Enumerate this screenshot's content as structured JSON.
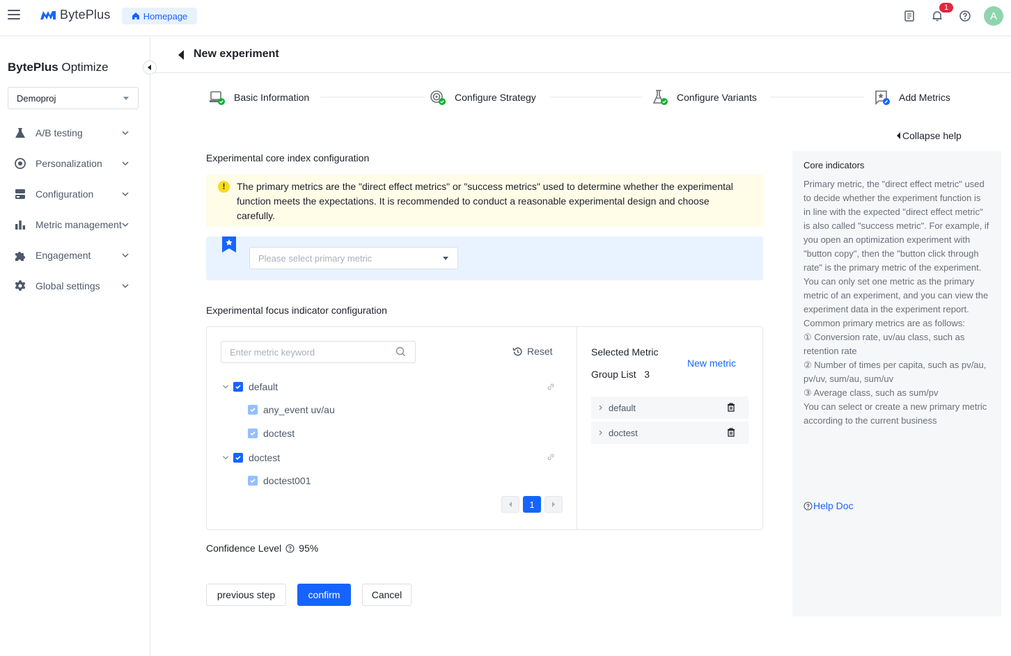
{
  "topbar": {
    "brand": "BytePlus",
    "home_label": "Homepage",
    "notification_count": "1",
    "avatar_initial": "A",
    "icons": [
      "menu-icon",
      "document-icon",
      "bell-icon",
      "help-icon"
    ]
  },
  "sidebar": {
    "title_bold": "BytePlus",
    "title_light": " Optimize",
    "project": "Demoproj",
    "items": [
      {
        "label": "A/B testing",
        "icon": "flask-icon"
      },
      {
        "label": "Personalization",
        "icon": "target-icon"
      },
      {
        "label": "Configuration",
        "icon": "server-icon"
      },
      {
        "label": "Metric management",
        "icon": "bar-chart-icon"
      },
      {
        "label": "Engagement",
        "icon": "puzzle-icon"
      },
      {
        "label": "Global settings",
        "icon": "gear-icon"
      }
    ]
  },
  "page": {
    "title": "New experiment"
  },
  "steps": [
    {
      "label": "Basic Information",
      "status": "done"
    },
    {
      "label": "Configure Strategy",
      "status": "done"
    },
    {
      "label": "Configure Variants",
      "status": "done"
    },
    {
      "label": "Add Metrics",
      "status": "current"
    }
  ],
  "core": {
    "section_title": "Experimental core index configuration",
    "alert_text": "The primary metrics are the \"direct effect metrics\" or \"success metrics\" used to determine whether the experimental function meets the expectations. It is recommended to conduct a reasonable experimental design and choose carefully.",
    "primary_placeholder": "Please select primary metric"
  },
  "focus": {
    "section_title": "Experimental focus indicator configuration",
    "search_placeholder": "Enter metric keyword",
    "reset_label": "Reset",
    "tree": [
      {
        "label": "default",
        "children": [
          "any_event uv/au",
          "doctest"
        ]
      },
      {
        "label": "doctest",
        "children": [
          "doctest001"
        ]
      }
    ],
    "pagination": {
      "current_page": "1"
    },
    "selected_metric_label": "Selected Metric",
    "group_list_label": "Group List",
    "group_count": "3",
    "new_metric_label": "New metric",
    "groups": [
      "default",
      "doctest"
    ]
  },
  "confidence": {
    "label": "Confidence Level",
    "value": "95%"
  },
  "actions": {
    "previous": "previous step",
    "confirm": "confirm",
    "cancel": "Cancel"
  },
  "help": {
    "collapse_label": "Collapse help",
    "title": "Core indicators",
    "body": "Primary metric, the \"direct effect metric\" used to decide whether the experiment function is in line with the expected \"direct effect metric\" is also called \"success metric\". For example, if you open an optimization experiment with \"button copy\", then the \"button click through rate\" is the primary metric of the experiment. You can only set one metric as the primary metric of an experiment, and you can view the experiment data in the experiment report.",
    "common_intro": "Common primary metrics are as follows:",
    "common_items": [
      "① Conversion rate, uv/au class, such as retention rate",
      "② Number of times per capita, such as pv/au, pv/uv, sum/au, sum/uv",
      "③ Average class, such as sum/pv"
    ],
    "footer": "You can select or create a new primary metric according to the current business",
    "doc_link": "Help Doc"
  },
  "colors": {
    "primary": "#1664ff",
    "success": "#00b42a",
    "warning_bg": "#fffce8",
    "info_bg": "#e8f3ff",
    "badge": "#e0283c",
    "avatar": "#8fd4ae"
  }
}
